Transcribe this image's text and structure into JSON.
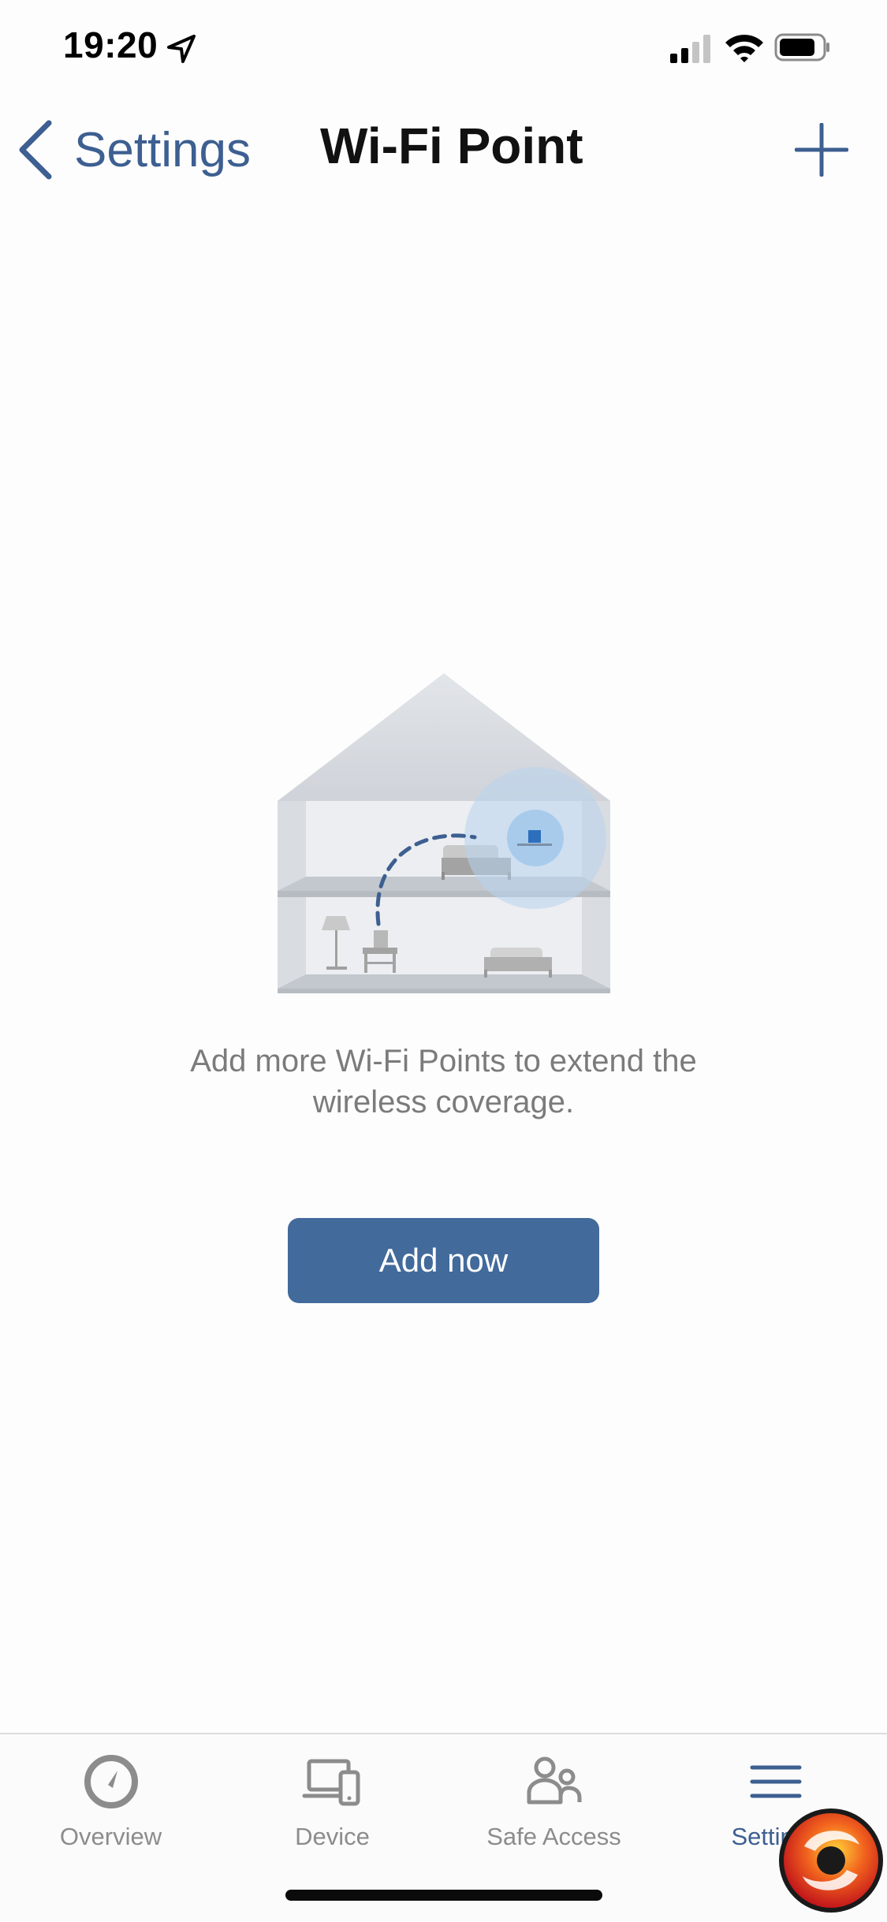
{
  "status": {
    "time": "19:20"
  },
  "nav": {
    "back_label": "Settings",
    "title": "Wi-Fi Point"
  },
  "empty_state": {
    "message_line1": "Add more Wi-Fi Points to extend the",
    "message_line2": "wireless coverage.",
    "button_label": "Add now"
  },
  "tabs": [
    {
      "label": "Overview",
      "icon": "gauge-icon"
    },
    {
      "label": "Device",
      "icon": "devices-icon"
    },
    {
      "label": "Safe Access",
      "icon": "people-icon"
    },
    {
      "label": "Settings",
      "icon": "menu-icon",
      "active": true
    }
  ],
  "colors": {
    "accent": "#426a9b",
    "link": "#3d5f91"
  }
}
